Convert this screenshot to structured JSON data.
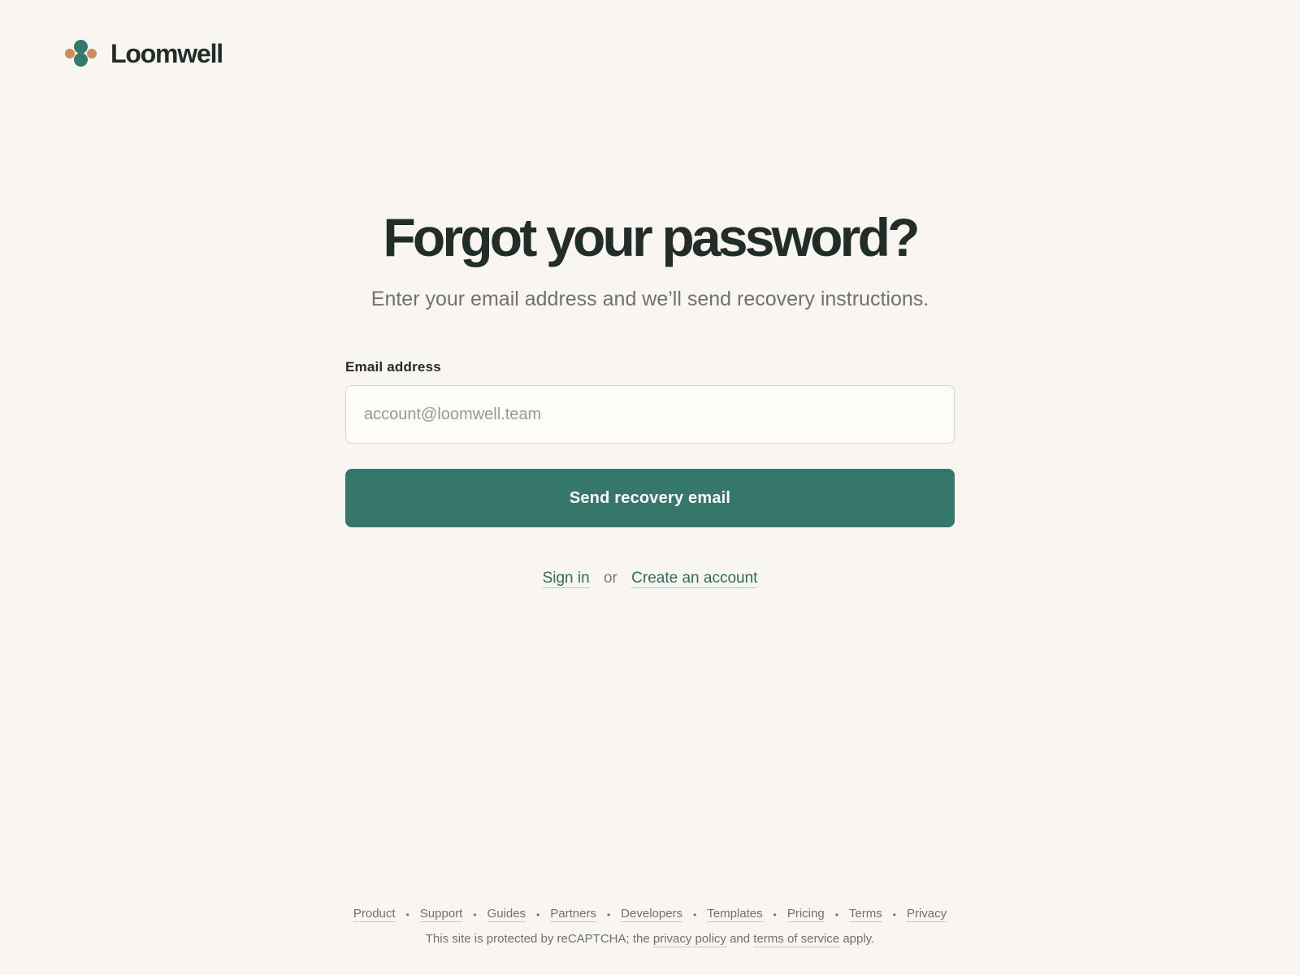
{
  "brand": {
    "name": "Loomwell",
    "colors": {
      "primary": "#34796c",
      "secondary": "#cf8b5a"
    }
  },
  "page": {
    "title": "Forgot your password?",
    "subtitle": "Enter your email address and we’ll send recovery instructions."
  },
  "form": {
    "email_label": "Email address",
    "email_value": "",
    "email_placeholder": "account@loomwell.team",
    "submit_label": "Send recovery email",
    "submit_color": "#35776b"
  },
  "alt_links": {
    "sign_in": "Sign in",
    "or": "or",
    "create_account": "Create an account"
  },
  "footer": {
    "links": [
      "Product",
      "Support",
      "Guides",
      "Partners",
      "Developers",
      "Templates",
      "Pricing",
      "Terms",
      "Privacy"
    ],
    "separator": "•",
    "legal": {
      "prefix": "This site is protected by reCAPTCHA; the",
      "privacy_link": "privacy policy",
      "middle": "and",
      "terms_link": "terms of service",
      "suffix": "apply."
    }
  }
}
